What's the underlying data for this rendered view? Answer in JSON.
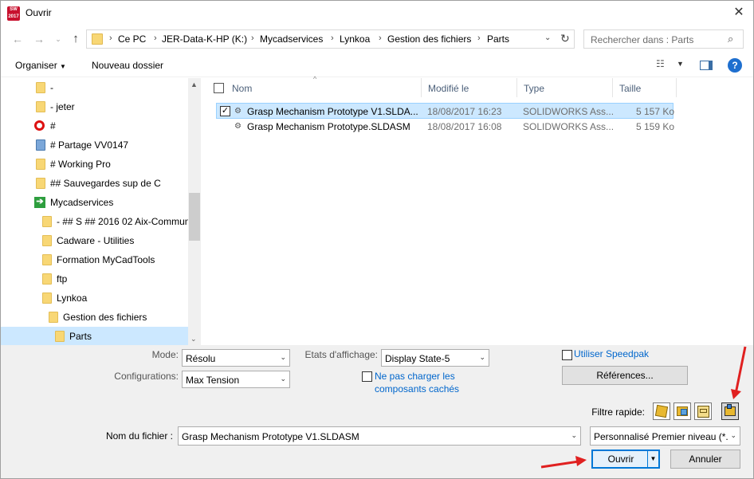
{
  "window": {
    "title": "Ouvrir",
    "app_icon_text": "SW 2017"
  },
  "address": {
    "crumbs": [
      "Ce PC",
      "JER-Data-K-HP (K:)",
      "Mycadservices",
      "Lynkoa",
      "Gestion des fichiers",
      "Parts"
    ]
  },
  "search": {
    "placeholder": "Rechercher dans : Parts"
  },
  "toolbar": {
    "organiser": "Organiser",
    "new_folder": "Nouveau dossier"
  },
  "tree": {
    "items": [
      {
        "label": "-",
        "icon": "folder-icon"
      },
      {
        "label": "- jeter",
        "icon": "folder-icon"
      },
      {
        "label": "#",
        "icon": "no-access-icon"
      },
      {
        "label": "# Partage VV0147",
        "icon": "shared-users-icon"
      },
      {
        "label": "# Working Pro",
        "icon": "folder-icon"
      },
      {
        "label": "## Sauvegardes sup de C",
        "icon": "folder-icon"
      },
      {
        "label": "Mycadservices",
        "icon": "green-arrow-icon"
      },
      {
        "label": "- ## S ## 2016 02 Aix-Commun",
        "icon": "folder-icon"
      },
      {
        "label": "Cadware - Utilities",
        "icon": "folder-icon"
      },
      {
        "label": "Formation MyCadTools",
        "icon": "folder-icon"
      },
      {
        "label": "ftp",
        "icon": "folder-icon"
      },
      {
        "label": "Lynkoa",
        "icon": "folder-icon"
      },
      {
        "label": "Gestion des fichiers",
        "icon": "folder-icon"
      },
      {
        "label": "Parts",
        "icon": "folder-icon"
      }
    ]
  },
  "files": {
    "headers": {
      "name": "Nom",
      "modified": "Modifié le",
      "type": "Type",
      "size": "Taille"
    },
    "rows": [
      {
        "name": "Grasp Mechanism Prototype V1.SLDA...",
        "modified": "18/08/2017 16:23",
        "type": "SOLIDWORKS Ass...",
        "size": "5 157 Ko",
        "selected": true
      },
      {
        "name": "Grasp Mechanism Prototype.SLDASM",
        "modified": "18/08/2017 16:08",
        "type": "SOLIDWORKS Ass...",
        "size": "5 159 Ko",
        "selected": false
      }
    ]
  },
  "options": {
    "mode_label": "Mode:",
    "mode_value": "Résolu",
    "config_label": "Configurations:",
    "config_value": "Max Tension",
    "display_label": "Etats d'affichage:",
    "display_value": "Display State-5",
    "no_load_hidden": "Ne pas charger les composants cachés",
    "no_load_line1": "Ne pas charger les",
    "no_load_line2": "composants cachés",
    "speedpak": "Utiliser Speedpak",
    "references": "Références...",
    "quick_filter": "Filtre rapide:",
    "filename_label": "Nom du fichier :",
    "filename_value": "Grasp Mechanism Prototype V1.SLDASM",
    "filter_value": "Personnalisé Premier niveau (*.",
    "open": "Ouvrir",
    "cancel": "Annuler"
  },
  "colors": {
    "selection": "#cce8ff",
    "link": "#0066cc",
    "annotation_arrow": "#e02020"
  }
}
